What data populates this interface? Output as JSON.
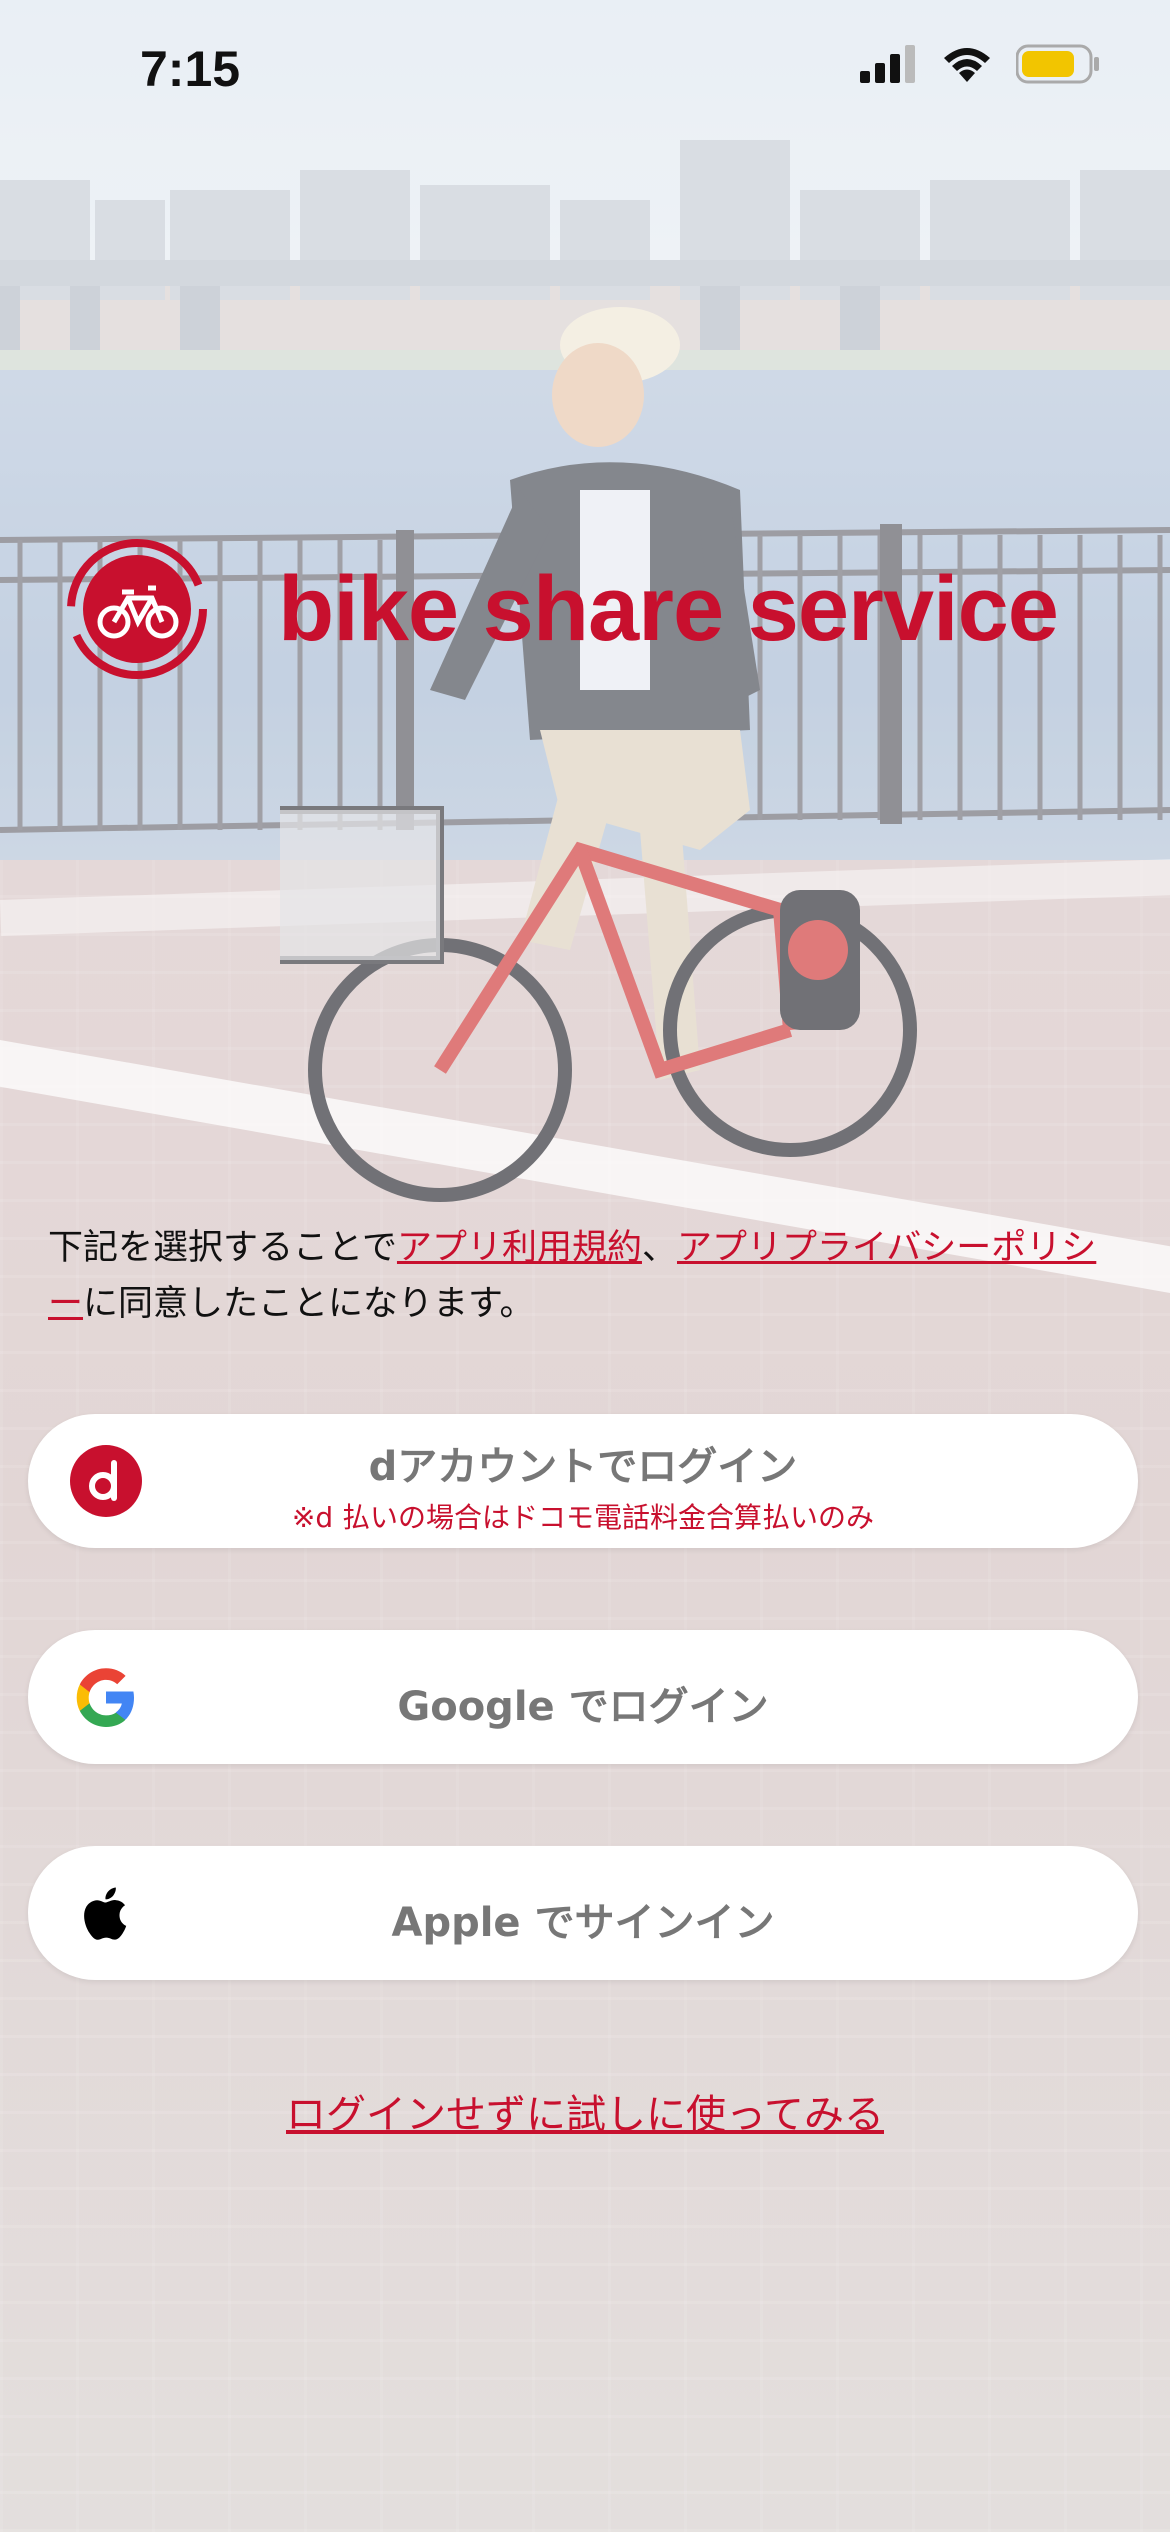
{
  "status_bar": {
    "time": "7:15"
  },
  "brand": {
    "name": "bike share service",
    "color": "#c8102e"
  },
  "terms": {
    "prefix": "下記を選択することで",
    "link_terms": "アプリ利用規約",
    "separator": "、",
    "link_privacy": "アプリプライバシーポリシー",
    "suffix": "に同意したことになります。"
  },
  "buttons": {
    "docomo": {
      "label": "dアカウントでログイン",
      "note": "※d 払いの場合はドコモ電話料金合算払いのみ",
      "icon": "docomo-d-icon"
    },
    "google": {
      "label": "Google でログイン",
      "icon": "google-icon"
    },
    "apple": {
      "label": "Apple でサインイン",
      "icon": "apple-icon"
    }
  },
  "trial_link": "ログインせずに試しに使ってみる",
  "colors": {
    "accent": "#c8102e",
    "button_bg": "#ffffff",
    "button_text": "#777777"
  }
}
